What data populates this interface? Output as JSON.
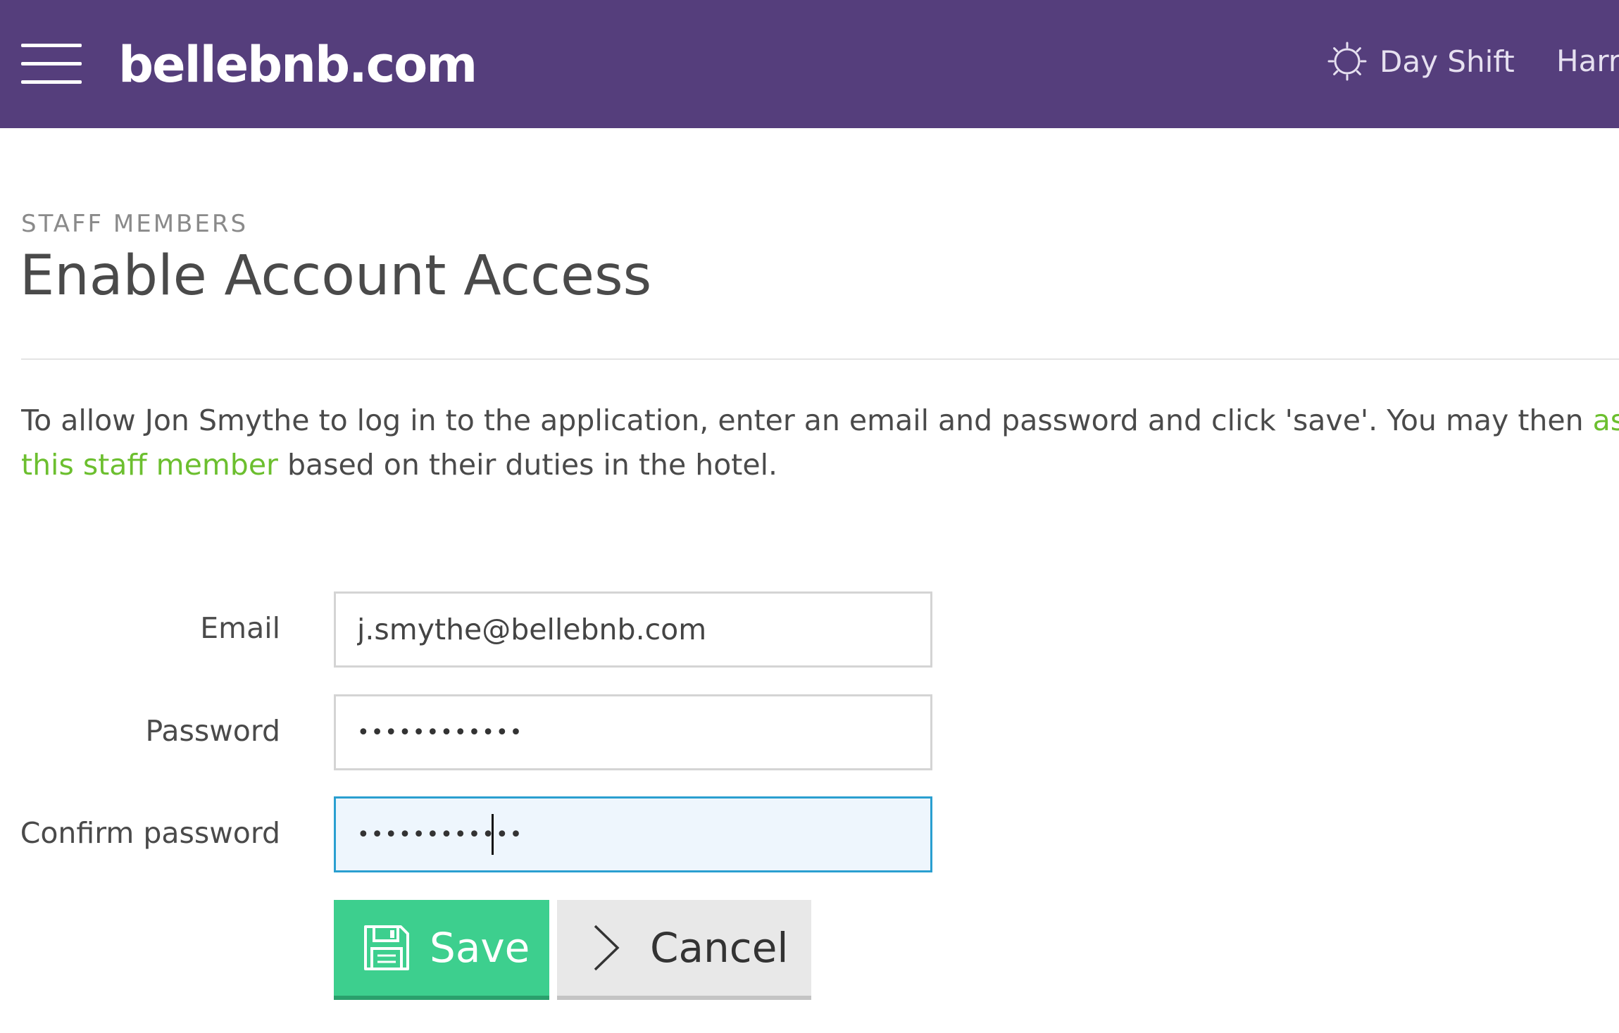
{
  "header": {
    "logo_text": "bellebnb.com",
    "shift_label": "Day Shift",
    "user_name": "Harr",
    "colors": {
      "bar": "#553e7c",
      "text": "#ffffff"
    },
    "icons": {
      "menu": "hamburger-menu-icon",
      "shift": "sun-icon"
    }
  },
  "page": {
    "eyebrow": "STAFF MEMBERS",
    "title": "Enable Account Access"
  },
  "intro": {
    "line1_text": "To allow Jon Smythe to log in to the application, enter an email and password and click 'save'. You may then ",
    "link_part1": "assign",
    "link_part2": "this staff member",
    "line2_text": " based on their duties in the hotel.",
    "link_color": "#6cbf2f"
  },
  "form": {
    "email": {
      "label": "Email",
      "value": "j.smythe@bellebnb.com"
    },
    "password": {
      "label": "Password",
      "value": "••••••••••••"
    },
    "confirm_password": {
      "label": "Confirm password",
      "value": "••••••••••••"
    }
  },
  "actions": {
    "save_label": "Save",
    "cancel_label": "Cancel",
    "save_color": "#3dcf8e",
    "cancel_color": "#e8e8e8",
    "icons": {
      "save": "floppy-disk-icon",
      "cancel": "chevron-right-icon"
    }
  }
}
